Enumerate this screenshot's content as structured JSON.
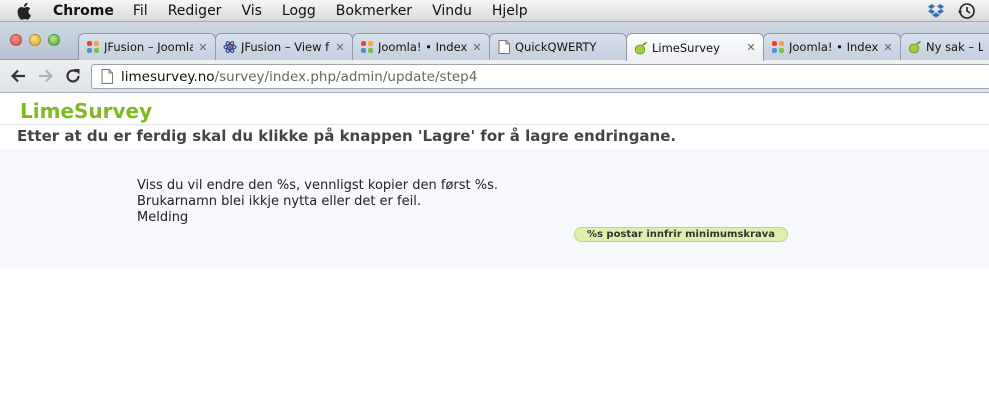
{
  "menubar": {
    "app_name": "Chrome",
    "items": [
      "Fil",
      "Rediger",
      "Vis",
      "Logg",
      "Bokmerker",
      "Vindu",
      "Hjelp"
    ]
  },
  "tabs": [
    {
      "title": "JFusion – Joomla",
      "icon": "joomla-icon",
      "active": false
    },
    {
      "title": "JFusion – View fo",
      "icon": "jfusion-icon",
      "active": false
    },
    {
      "title": "Joomla! • Index |",
      "icon": "joomla-icon",
      "active": false
    },
    {
      "title": "QuickQWERTY",
      "icon": "page-icon",
      "active": false
    },
    {
      "title": "LimeSurvey",
      "icon": "lime-icon",
      "active": true
    },
    {
      "title": "Joomla! • Index |",
      "icon": "joomla-icon",
      "active": false
    },
    {
      "title": "Ny sak – Lim",
      "icon": "lime-icon",
      "active": false
    }
  ],
  "address": {
    "host": "limesurvey.no",
    "path": "/survey/index.php/admin/update/step4"
  },
  "page": {
    "brand": "LimeSurvey",
    "heading": "Etter at du er ferdig skal du klikke på knappen 'Lagre' for å lagre endringane.",
    "messages": [
      "Viss du vil endre den %s, vennligst kopier den først %s.",
      "Brukarnamn blei ikkje nytta eller det er feil.",
      "Melding"
    ],
    "badge": "%s postar innfrir minimumskrava"
  },
  "colors": {
    "brand": "#7fba20",
    "panel": "#f7f8fc",
    "badge": "#ddf0b0"
  }
}
